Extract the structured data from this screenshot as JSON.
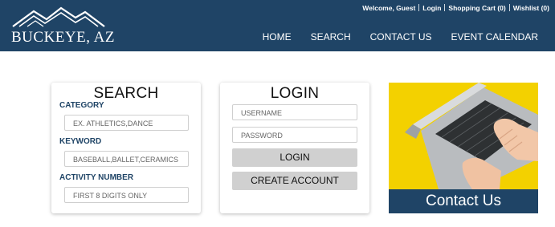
{
  "header": {
    "logo_text": "BUCKEYE, AZ",
    "utility": {
      "welcome": "Welcome, Guest",
      "login": "Login",
      "cart": "Shopping Cart (0)",
      "wishlist": "Wishlist (0)"
    },
    "nav": [
      "HOME",
      "SEARCH",
      "CONTACT US",
      "EVENT CALENDAR"
    ]
  },
  "search": {
    "title": "SEARCH",
    "category_label": "CATEGORY",
    "category_placeholder": "EX. ATHLETICS,DANCE",
    "keyword_label": "KEYWORD",
    "keyword_placeholder": "BASEBALL,BALLET,CERAMICS",
    "activity_label": "ACTIVITY NUMBER",
    "activity_placeholder": "FIRST 8 DIGITS ONLY"
  },
  "login": {
    "title": "LOGIN",
    "username_placeholder": "USERNAME",
    "password_placeholder": "PASSWORD",
    "login_button": "LOGIN",
    "create_button": "CREATE ACCOUNT"
  },
  "contact": {
    "label": "Contact Us"
  },
  "colors": {
    "header_bg": "#1f4466",
    "accent_yellow": "#f3d100",
    "button_gray": "#d0d0d0"
  }
}
